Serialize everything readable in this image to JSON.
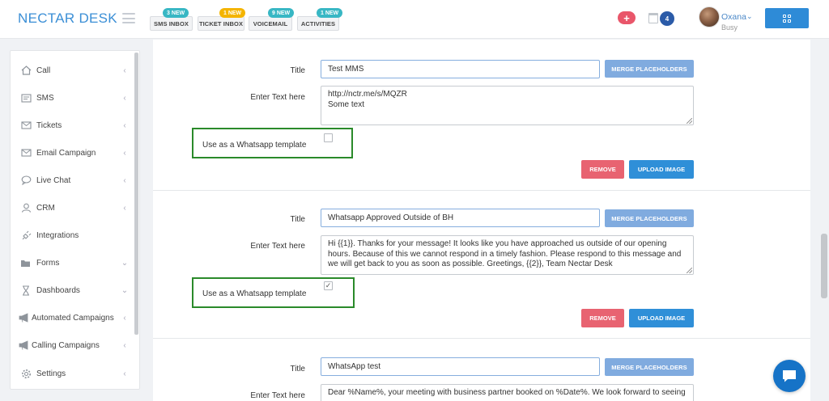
{
  "app": {
    "logo": "NECTAR DESK"
  },
  "header": {
    "inboxes": [
      {
        "label": "SMS INBOX",
        "badge": "3 NEW",
        "badge_color": "#38b7c4"
      },
      {
        "label": "TICKET INBOX",
        "badge": "1 NEW",
        "badge_color": "#f4b400"
      },
      {
        "label": "VOICEMAIL",
        "badge": "9 NEW",
        "badge_color": "#38b7c4"
      },
      {
        "label": "ACTIVITIES",
        "badge": "1 NEW",
        "badge_color": "#38b7c4"
      }
    ],
    "plus_label": "+",
    "calendar_count": "4",
    "user": {
      "name": "Oxana",
      "status": "Busy"
    }
  },
  "sidebar": {
    "items": [
      {
        "label": "Call",
        "icon": "home-icon",
        "chevron": "‹"
      },
      {
        "label": "SMS",
        "icon": "sms-icon",
        "chevron": "‹"
      },
      {
        "label": "Tickets",
        "icon": "ticket-icon",
        "chevron": "‹"
      },
      {
        "label": "Email Campaign",
        "icon": "mail-icon",
        "chevron": "‹"
      },
      {
        "label": "Live Chat",
        "icon": "chat-bubble-icon",
        "chevron": "‹"
      },
      {
        "label": "CRM",
        "icon": "user-icon",
        "chevron": "‹"
      },
      {
        "label": "Integrations",
        "icon": "plug-icon",
        "chevron": ""
      },
      {
        "label": "Forms",
        "icon": "folder-icon",
        "chevron": "⌄"
      },
      {
        "label": "Dashboards",
        "icon": "hourglass-icon",
        "chevron": "⌄"
      },
      {
        "label": "Automated Campaigns",
        "icon": "megaphone-icon",
        "chevron": "‹"
      },
      {
        "label": "Calling Campaigns",
        "icon": "megaphone-icon",
        "chevron": "‹"
      },
      {
        "label": "Settings",
        "icon": "gear-icon",
        "chevron": "‹"
      }
    ]
  },
  "templates": [
    {
      "title_label": "Title",
      "title_value": "Test MMS",
      "text_label": "Enter Text here",
      "text_value": "http://nctr.me/s/MQZR\nSome text",
      "whatsapp_label": "Use as a Whatsapp template",
      "whatsapp_checked": "",
      "merge_label": "MERGE PLACEHOLDERS",
      "remove_label": "REMOVE",
      "upload_label": "UPLOAD IMAGE"
    },
    {
      "title_label": "Title",
      "title_value": "Whatsapp Approved Outside of BH",
      "text_label": "Enter Text here",
      "text_value": "Hi {{1}}. Thanks for your message! It looks like you have approached us outside of our opening hours. Because of this we cannot respond in a timely fashion. Please respond to this message and we will get back to you as soon as possible. Greetings, {{2}}, Team Nectar Desk",
      "whatsapp_label": "Use as a Whatsapp template",
      "whatsapp_checked": "✓",
      "merge_label": "MERGE PLACEHOLDERS",
      "remove_label": "REMOVE",
      "upload_label": "UPLOAD IMAGE"
    },
    {
      "title_label": "Title",
      "title_value": "WhatsApp test",
      "text_label": "Enter Text here",
      "text_value": "Dear %Name%, your meeting with business partner booked on %Date%. We look forward to seeing",
      "merge_label": "MERGE PLACEHOLDERS"
    }
  ],
  "colors": {
    "accent": "#2f8fd8",
    "merge": "#80abdf",
    "remove": "#e86371",
    "highlight_border": "#2a8a2a"
  }
}
